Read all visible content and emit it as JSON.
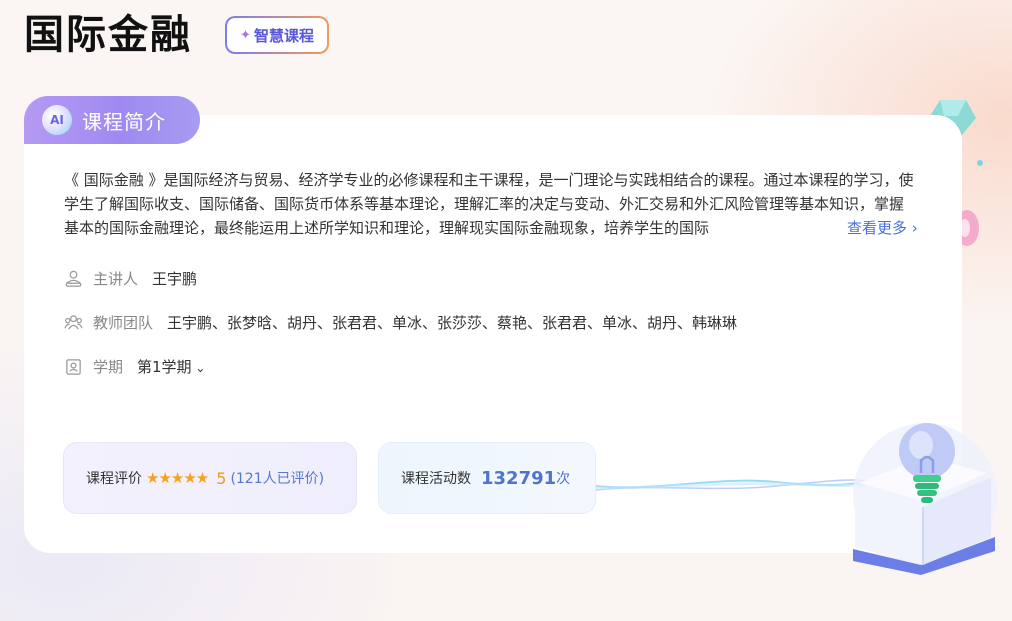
{
  "header": {
    "title": "国际金融",
    "tag_label": "智慧课程"
  },
  "intro": {
    "section_title": "课程简介",
    "ai_badge": "AI",
    "description": "《 国际金融 》是国际经济与贸易、经济学专业的必修课程和主干课程，是一门理论与实践相结合的课程。通过本课程的学习，使学生了解国际收支、国际储备、国际货币体系等基本理论，理解汇率的决定与变动、外汇交易和外汇风险管理等基本知识，掌握基本的国际金融理论，最终能运用上述所学知识和理论，理解现实国际金融现象，培养学生的国际",
    "more_label": "查看更多"
  },
  "info": {
    "lecturer_label": "主讲人",
    "lecturer": "王宇鹏",
    "team_label": "教师团队",
    "team": "王宇鹏、张梦晗、胡丹、张君君、单冰、张莎莎、蔡艳、张君君、单冰、胡丹、韩琳琳",
    "term_label": "学期",
    "term": "第1学期"
  },
  "stats": {
    "rating_label": "课程评价",
    "stars": "★★★★★",
    "score": "5",
    "rating_count": "(121人已评价)",
    "activity_label": "课程活动数",
    "activity_value": "132791",
    "activity_unit": "次"
  },
  "colors": {
    "accent": "#9f8af0",
    "link": "#4a6ee0",
    "star": "#f7a21b"
  }
}
